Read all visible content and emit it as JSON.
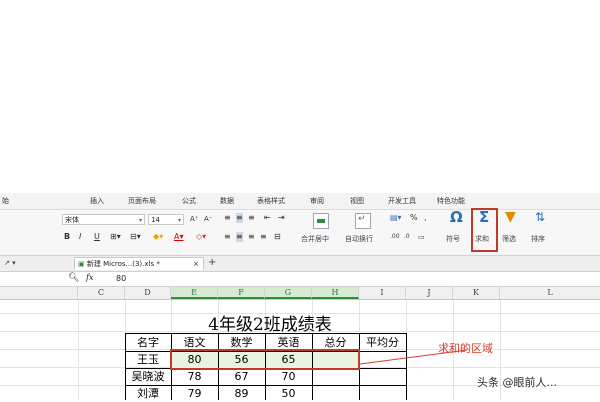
{
  "ribbon_tabs": [
    "始",
    "插入",
    "页面布局",
    "公式",
    "数据",
    "表格样式",
    "审阅",
    "视图",
    "开发工具",
    "特色功能"
  ],
  "font": {
    "name": "宋体",
    "size": "14"
  },
  "toolbar": {
    "bold": "B",
    "italic": "I",
    "underline": "U",
    "merge_center": "合并居中",
    "wrap_text": "自动换行",
    "symbol": "符号",
    "sum": "求和",
    "filter": "筛选",
    "sort": "排序",
    "percent": "%",
    "comma": ","
  },
  "document_tab": {
    "name": "新建 Micros...(3).xls *",
    "close": "×",
    "add": "+"
  },
  "formula_bar": {
    "value": "80",
    "fx": "fx"
  },
  "column_headers": [
    "C",
    "D",
    "E",
    "F",
    "G",
    "H",
    "I",
    "J",
    "K",
    "L"
  ],
  "sheet": {
    "title": "4年级2班成绩表",
    "headers": [
      "名字",
      "语文",
      "数学",
      "英语",
      "总分",
      "平均分"
    ],
    "rows": [
      [
        "王玉",
        "80",
        "56",
        "65",
        "",
        ""
      ],
      [
        "吴晓波",
        "78",
        "67",
        "70",
        "",
        ""
      ],
      [
        "刘潭",
        "79",
        "89",
        "50",
        "",
        ""
      ]
    ]
  },
  "annotation": "求和的区域",
  "watermark": "头条 @眼前人..."
}
